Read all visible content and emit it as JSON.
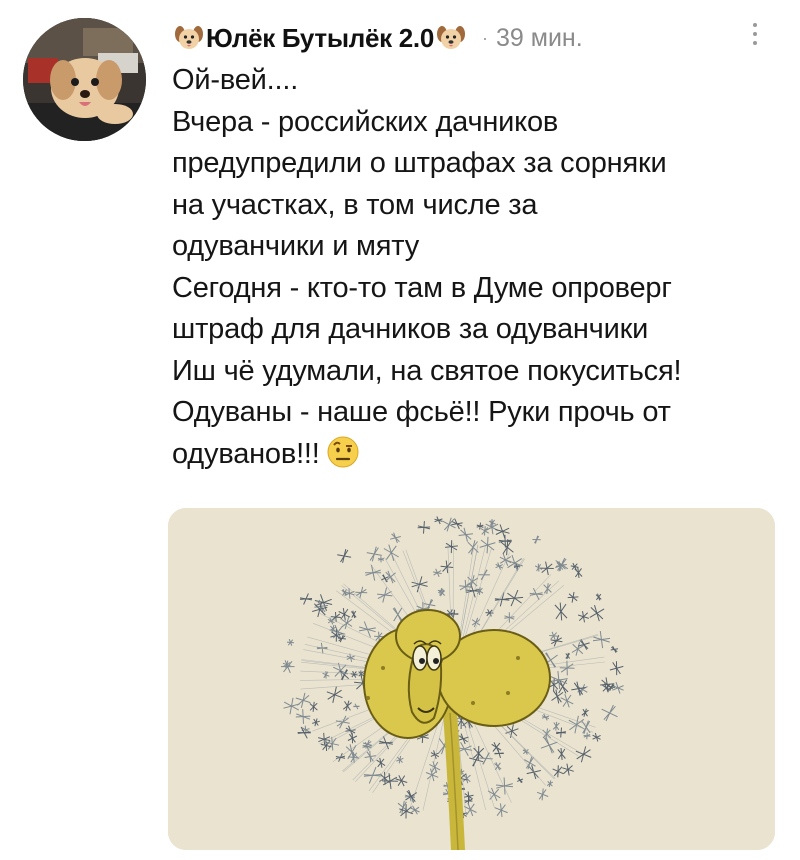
{
  "post": {
    "author": "Юлёк Бутылёк 2.0",
    "time_separator": "·",
    "time": "39 мин.",
    "lines": [
      "Ой-вей....",
      "Вчера - российских дачников",
      "предупредили о штрафах за сорняки",
      "на участках, в том числе за",
      "одуванчики и мяту",
      "Сегодня - кто-то там в Думе опроверг",
      "штраф для дачников за одуванчики",
      "Иш чё удумали, на святое покуситься!",
      "Одуваны - наше фсьё!! Руки прочь от",
      "одуванов!!!"
    ]
  },
  "icons": {
    "author_prefix": "dog-face-icon",
    "author_suffix": "dog-face-icon",
    "menu": "vertical-dots-menu-icon",
    "text_emoji": "face-with-raised-eyebrow-icon"
  },
  "colors": {
    "text": "#151515",
    "muted": "#8a8a8a",
    "background": "#ffffff",
    "media_bg": "#e9e2cf",
    "dandelion_yellow": "#d8c64a"
  }
}
